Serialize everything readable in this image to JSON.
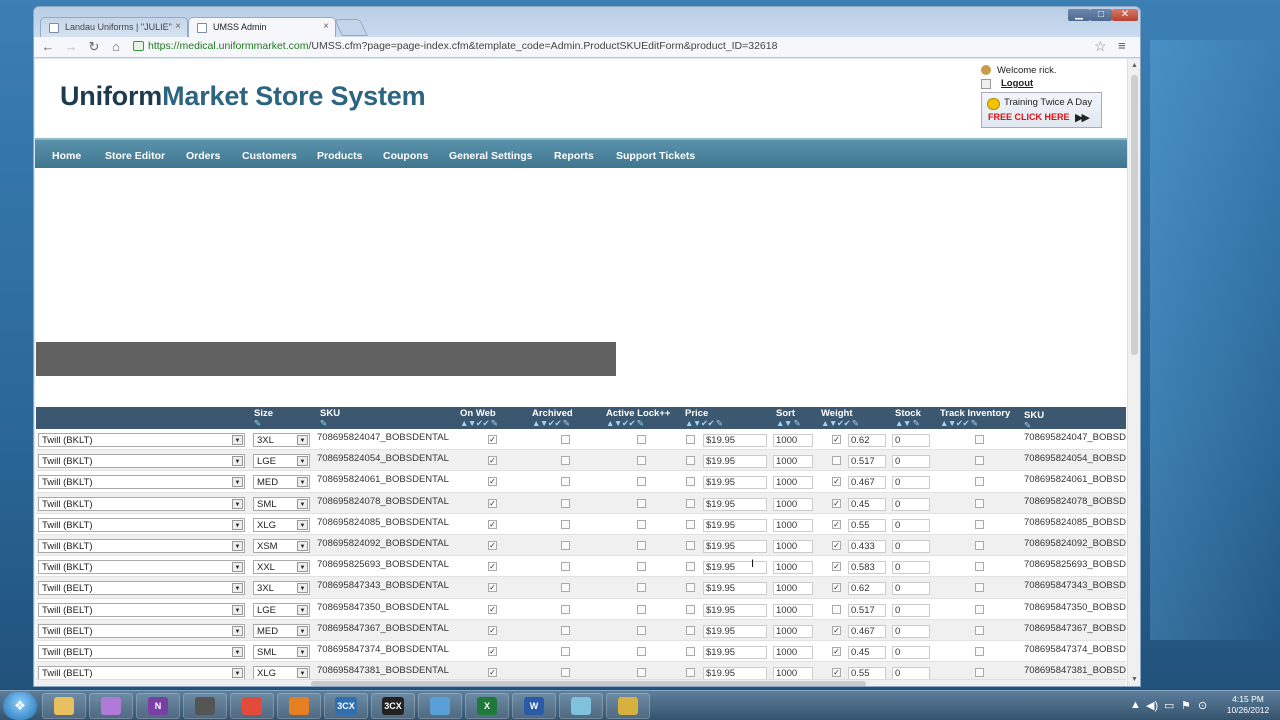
{
  "browser": {
    "tabs": [
      {
        "label": "Landau Uniforms | \"JULIE\""
      },
      {
        "label": "UMSS Admin"
      }
    ],
    "url_scheme": "https://",
    "url_domain": "medical.uniformmarket.com",
    "url_path": "/UMSS.cfm?page=page-index.cfm&template_code=Admin.ProductSKUEditForm&product_ID=32618"
  },
  "header": {
    "logo_part1": "Uniform",
    "logo_part2": "Market Store System",
    "welcome": "Welcome rick.",
    "logout": "Logout",
    "training_text": "Training Twice A Day",
    "training_cta": "FREE CLICK HERE"
  },
  "nav": {
    "items": [
      "Home",
      "Store Editor",
      "Orders",
      "Customers",
      "Products",
      "Coupons",
      "General Settings",
      "Reports",
      "Support Tickets"
    ]
  },
  "grid": {
    "columns": {
      "size": "Size",
      "sku": "SKU",
      "on_web": "On Web",
      "archived": "Archived",
      "active_lock": "Active Lock++",
      "price": "Price",
      "sort": "Sort",
      "weight": "Weight",
      "stock": "Stock",
      "track_inventory": "Track Inventory",
      "sku2": "SKU"
    },
    "rows": [
      {
        "color": "Twill (BKLT)",
        "size": "3XL",
        "sku": "708695824047_BOBSDENTAL",
        "on_web": true,
        "archived": false,
        "active_lock": false,
        "price_cb": false,
        "price": "$19.95",
        "sort": "1000",
        "weight_cb": true,
        "weight": "0.62",
        "stock": "0",
        "track": false,
        "sku2": "708695824047_BOBSD"
      },
      {
        "color": "Twill (BKLT)",
        "size": "LGE",
        "sku": "708695824054_BOBSDENTAL",
        "on_web": true,
        "archived": false,
        "active_lock": false,
        "price_cb": false,
        "price": "$19.95",
        "sort": "1000",
        "weight_cb": false,
        "weight": "0.517",
        "stock": "0",
        "track": false,
        "sku2": "708695824054_BOBSD"
      },
      {
        "color": "Twill (BKLT)",
        "size": "MED",
        "sku": "708695824061_BOBSDENTAL",
        "on_web": true,
        "archived": false,
        "active_lock": false,
        "price_cb": false,
        "price": "$19.95",
        "sort": "1000",
        "weight_cb": true,
        "weight": "0.467",
        "stock": "0",
        "track": false,
        "sku2": "708695824061_BOBSD"
      },
      {
        "color": "Twill (BKLT)",
        "size": "SML",
        "sku": "708695824078_BOBSDENTAL",
        "on_web": true,
        "archived": false,
        "active_lock": false,
        "price_cb": false,
        "price": "$19.95",
        "sort": "1000",
        "weight_cb": true,
        "weight": "0.45",
        "stock": "0",
        "track": false,
        "sku2": "708695824078_BOBSD"
      },
      {
        "color": "Twill (BKLT)",
        "size": "XLG",
        "sku": "708695824085_BOBSDENTAL",
        "on_web": true,
        "archived": false,
        "active_lock": false,
        "price_cb": false,
        "price": "$19.95",
        "sort": "1000",
        "weight_cb": true,
        "weight": "0.55",
        "stock": "0",
        "track": false,
        "sku2": "708695824085_BOBSD"
      },
      {
        "color": "Twill (BKLT)",
        "size": "XSM",
        "sku": "708695824092_BOBSDENTAL",
        "on_web": true,
        "archived": false,
        "active_lock": false,
        "price_cb": false,
        "price": "$19.95",
        "sort": "1000",
        "weight_cb": true,
        "weight": "0.433",
        "stock": "0",
        "track": false,
        "sku2": "708695824092_BOBSD"
      },
      {
        "color": "Twill (BKLT)",
        "size": "XXL",
        "sku": "708695825693_BOBSDENTAL",
        "on_web": true,
        "archived": false,
        "active_lock": false,
        "price_cb": false,
        "price": "$19.95",
        "sort": "1000",
        "weight_cb": true,
        "weight": "0.583",
        "stock": "0",
        "track": false,
        "sku2": "708695825693_BOBSD"
      },
      {
        "color": "Twill (BELT)",
        "size": "3XL",
        "sku": "708695847343_BOBSDENTAL",
        "on_web": true,
        "archived": false,
        "active_lock": false,
        "price_cb": false,
        "price": "$19.95",
        "sort": "1000",
        "weight_cb": true,
        "weight": "0.62",
        "stock": "0",
        "track": false,
        "sku2": "708695847343_BOBSD"
      },
      {
        "color": "Twill (BELT)",
        "size": "LGE",
        "sku": "708695847350_BOBSDENTAL",
        "on_web": true,
        "archived": false,
        "active_lock": false,
        "price_cb": false,
        "price": "$19.95",
        "sort": "1000",
        "weight_cb": false,
        "weight": "0.517",
        "stock": "0",
        "track": false,
        "sku2": "708695847350_BOBSD"
      },
      {
        "color": "Twill (BELT)",
        "size": "MED",
        "sku": "708695847367_BOBSDENTAL",
        "on_web": true,
        "archived": false,
        "active_lock": false,
        "price_cb": false,
        "price": "$19.95",
        "sort": "1000",
        "weight_cb": true,
        "weight": "0.467",
        "stock": "0",
        "track": false,
        "sku2": "708695847367_BOBSD"
      },
      {
        "color": "Twill (BELT)",
        "size": "SML",
        "sku": "708695847374_BOBSDENTAL",
        "on_web": true,
        "archived": false,
        "active_lock": false,
        "price_cb": false,
        "price": "$19.95",
        "sort": "1000",
        "weight_cb": true,
        "weight": "0.45",
        "stock": "0",
        "track": false,
        "sku2": "708695847374_BOBSD"
      },
      {
        "color": "Twill (BELT)",
        "size": "XLG",
        "sku": "708695847381_BOBSDENTAL",
        "on_web": true,
        "archived": false,
        "active_lock": false,
        "price_cb": false,
        "price": "$19.95",
        "sort": "1000",
        "weight_cb": true,
        "weight": "0.55",
        "stock": "0",
        "track": false,
        "sku2": "708695847381_BOBSD"
      }
    ]
  },
  "taskbar": {
    "apps": [
      "explorer",
      "media",
      "onenote",
      "headset",
      "chrome",
      "firefox",
      "3cx-phone",
      "3cx",
      "remote",
      "excel",
      "word",
      "notes",
      "settings"
    ],
    "labels": {
      "onenote": "N",
      "3cx-phone": "3CX",
      "3cx": "3CX",
      "excel": "X",
      "word": "W"
    },
    "clock_time": "4:15 PM",
    "clock_date": "10/26/2012"
  }
}
